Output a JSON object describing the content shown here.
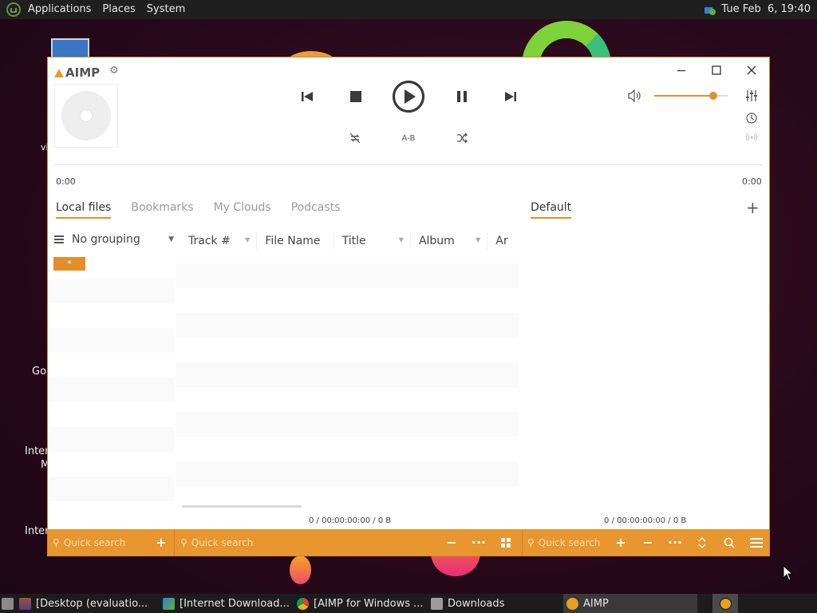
{
  "top_panel": {
    "menus": [
      "Applications",
      "Places",
      "System"
    ],
    "clock": "Tue Feb  6, 19:40"
  },
  "desktop": {
    "icon_labels": [
      "vi",
      "Go",
      "Intern",
      "M",
      "Intern"
    ]
  },
  "aimp": {
    "logo_text": "AIMP",
    "ab_label": "A-B",
    "time_left": "0:00",
    "time_right": "0:00",
    "volume_level": 0.8,
    "tabs": [
      "Local files",
      "Bookmarks",
      "My Clouds",
      "Podcasts"
    ],
    "active_tab": "Local files",
    "playlist_tab": "Default",
    "grouping_label": "No grouping",
    "columns": [
      "Track #",
      "File Name",
      "Title",
      "Album",
      "Ar"
    ],
    "group_item": "*",
    "library_stats": "0 / 00:00:00:00 / 0 B",
    "playlist_stats": "0 / 00:00:00:00 / 0 B",
    "quick_search_placeholder": "Quick search",
    "accent_color": "#e8962f"
  },
  "taskbar": {
    "items": [
      {
        "label": "[Desktop (evaluatio..."
      },
      {
        "label": "[Internet Download..."
      },
      {
        "label": "[AIMP for Windows ..."
      },
      {
        "label": "Downloads"
      },
      {
        "label": "AIMP"
      }
    ]
  }
}
